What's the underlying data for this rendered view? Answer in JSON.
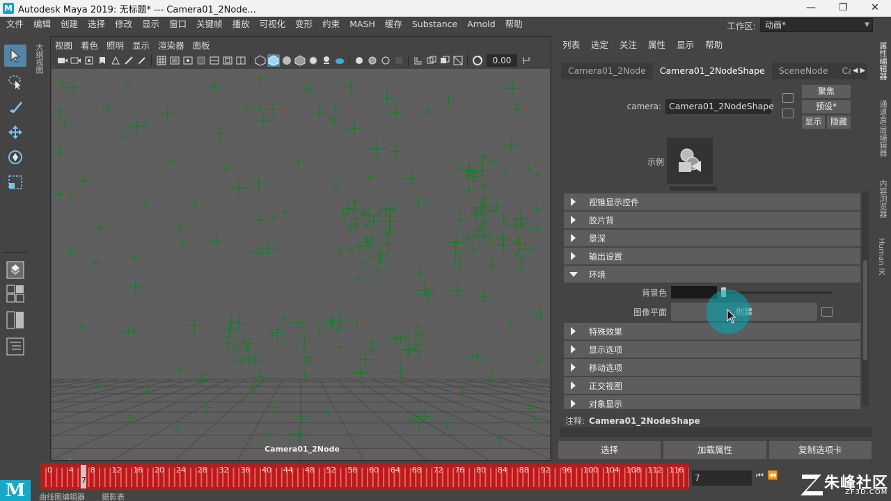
{
  "window": {
    "title": "Autodesk Maya 2019: 无标题*   ---   Camera01_2Node...",
    "min": "—",
    "restore": "❐",
    "close": "✕"
  },
  "menu": [
    "文件",
    "编辑",
    "创建",
    "选择",
    "修改",
    "显示",
    "窗口",
    "关键帧",
    "播放",
    "可视化",
    "变形",
    "约束",
    "MASH",
    "缓存",
    "Substance",
    "Arnold",
    "帮助"
  ],
  "workspace": {
    "label": "工作区:",
    "value": "动画*"
  },
  "outliner_tab": "大纲视图",
  "viewport": {
    "menus": [
      "视图",
      "着色",
      "照明",
      "显示",
      "渲染器",
      "面板"
    ],
    "zoom": "0.00",
    "camera_label": "Camera01_2Node"
  },
  "attribute_editor": {
    "menus": [
      "列表",
      "选定",
      "关注",
      "属性",
      "显示",
      "帮助"
    ],
    "tabs": [
      "Camera01_2Node",
      "Camera01_2NodeShape",
      "SceneNode",
      "Can"
    ],
    "active_tab": 1,
    "camera_label": "camera:",
    "camera_value": "Camera01_2NodeShape",
    "focus_btn": "聚焦",
    "preset_btn": "预设*",
    "show_btn": "显示",
    "hide_btn": "隐藏",
    "sample_label": "示例",
    "frames": [
      {
        "label": "视锥显示控件",
        "open": false
      },
      {
        "label": "胶片背",
        "open": false
      },
      {
        "label": "景深",
        "open": false
      },
      {
        "label": "输出设置",
        "open": false
      },
      {
        "label": "环境",
        "open": true
      },
      {
        "label": "特殊效果",
        "open": false
      },
      {
        "label": "显示选项",
        "open": false
      },
      {
        "label": "移动选项",
        "open": false
      },
      {
        "label": "正交视图",
        "open": false
      },
      {
        "label": "对象显示",
        "open": false
      }
    ],
    "bg_color_label": "背景色",
    "image_plane_label": "图像平面",
    "create_btn": "创建",
    "notes_label": "注释:",
    "notes_value": "Camera01_2NodeShape",
    "bottom_buttons": [
      "选择",
      "加载属性",
      "复制选项卡"
    ]
  },
  "right_tabs": [
    "属性编辑器",
    "通道盒/层编辑器",
    "内容浏览器",
    "Human IK"
  ],
  "timeline": {
    "ticks": [
      0,
      4,
      8,
      12,
      16,
      20,
      24,
      28,
      32,
      36,
      40,
      44,
      48,
      52,
      56,
      60,
      64,
      68,
      72,
      76,
      80,
      84,
      88,
      92,
      96,
      100,
      104,
      108,
      112,
      116
    ],
    "current": "7",
    "current_field": "7"
  },
  "bottom_tabs": [
    "曲线图编辑器",
    "摄影表"
  ],
  "watermark": {
    "text": "朱峰社区",
    "url": "ZF3D.COM"
  },
  "colors": {
    "accent": "#5285a6",
    "timeline": "#b31d1d",
    "click": "#00aab4",
    "locator": "#1e7a2a"
  }
}
